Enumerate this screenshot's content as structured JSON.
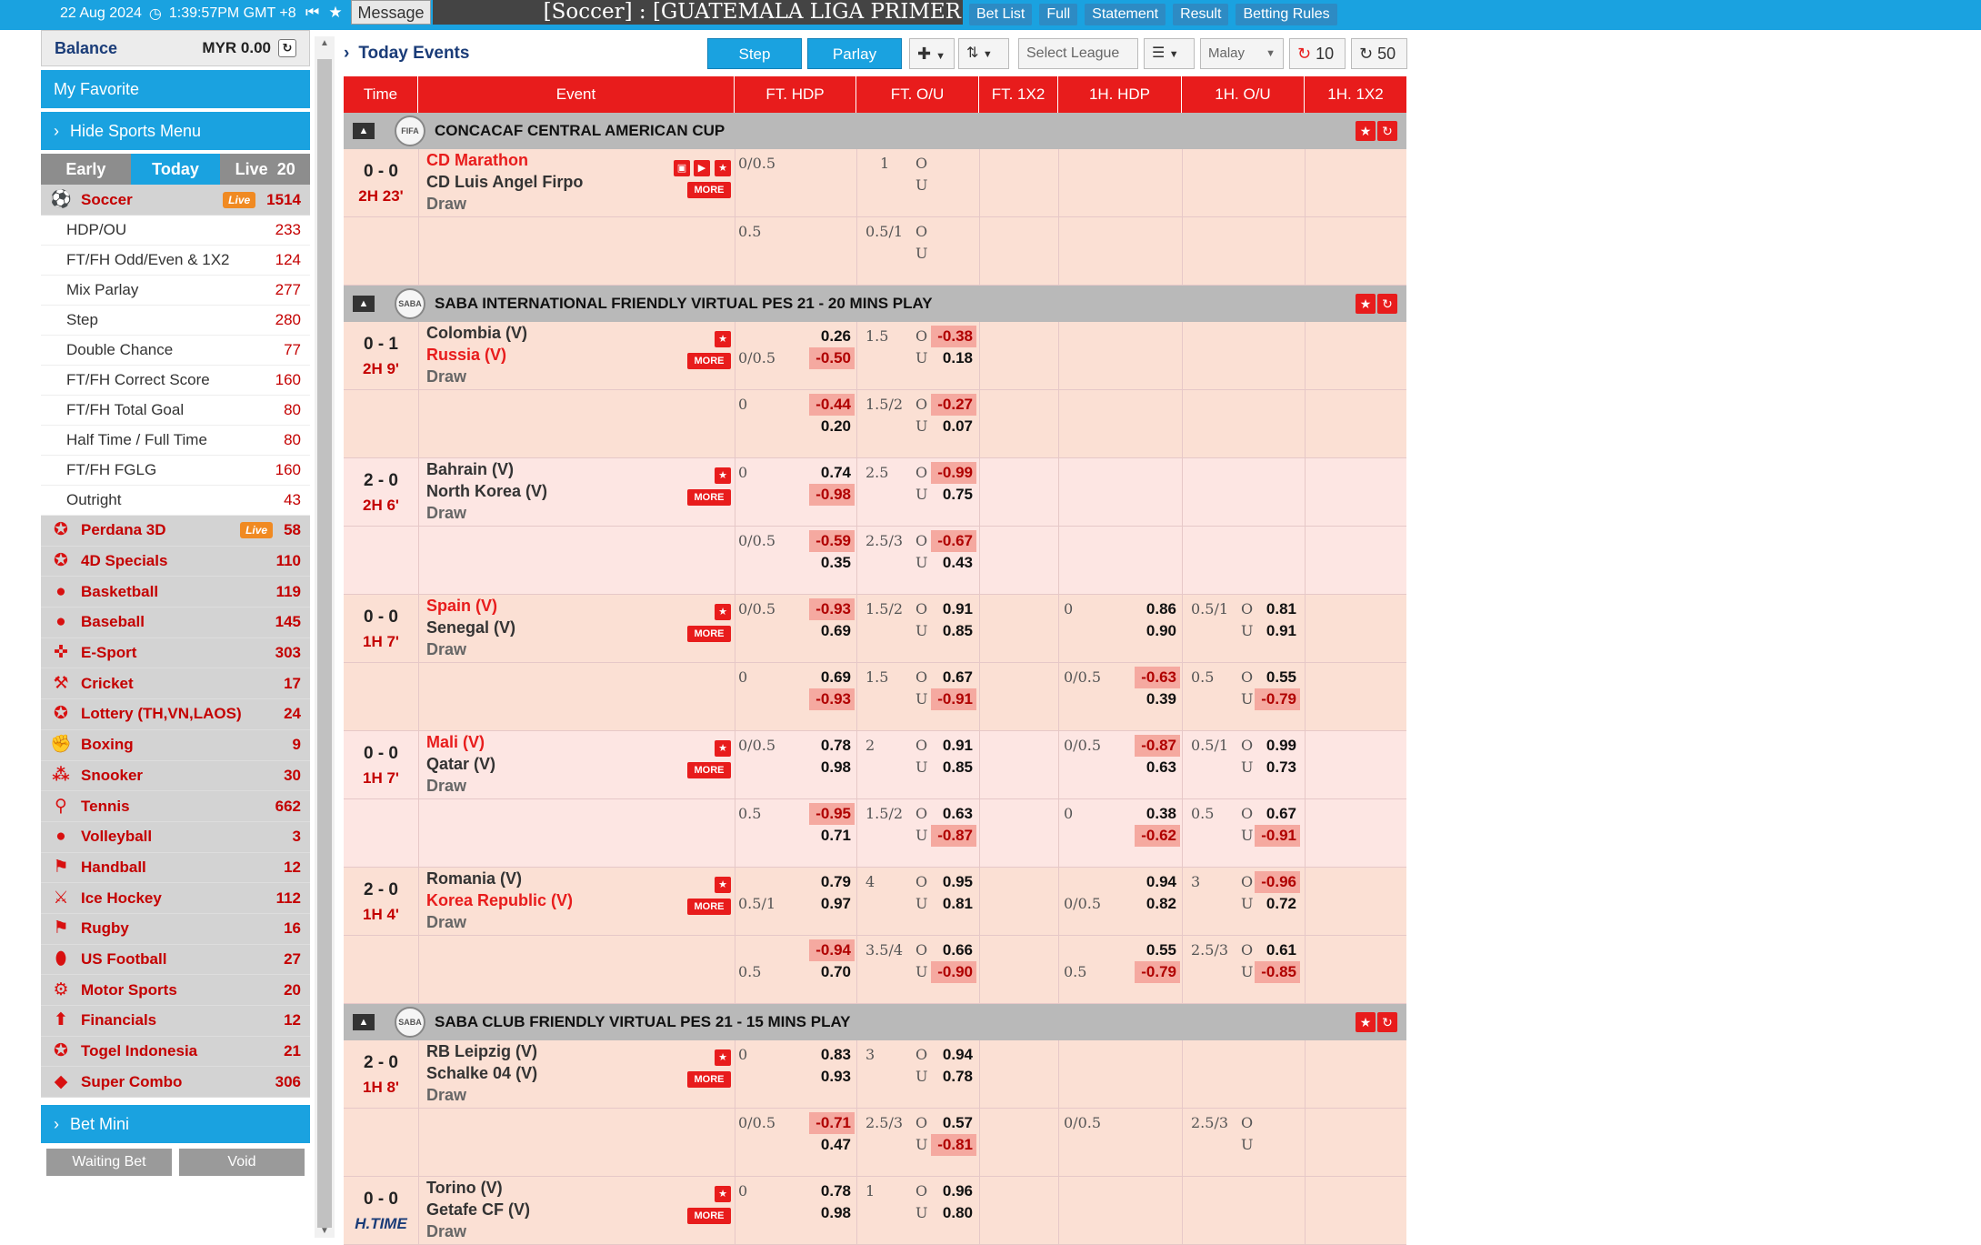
{
  "topbar": {
    "date": "22 Aug 2024",
    "time": "1:39:57PM GMT +8",
    "message_label": "Message",
    "ticker": "[Soccer] : [GUATEMALA LIGA PRIMER",
    "links": [
      "Bet List",
      "Full",
      "Statement",
      "Result",
      "Betting Rules"
    ]
  },
  "sidebar": {
    "balance_label": "Balance",
    "balance_value": "MYR 0.00",
    "favorite_label": "My Favorite",
    "hide_menu_label": "Hide Sports Menu",
    "tabs": {
      "early": "Early",
      "today": "Today",
      "live": "Live",
      "live_count": "20"
    },
    "soccer": {
      "name": "Soccer",
      "live": "Live",
      "count": "1514"
    },
    "soccer_sub": [
      {
        "name": "HDP/OU",
        "count": "233"
      },
      {
        "name": "FT/FH Odd/Even & 1X2",
        "count": "124"
      },
      {
        "name": "Mix Parlay",
        "count": "277"
      },
      {
        "name": "Step",
        "count": "280"
      },
      {
        "name": "Double Chance",
        "count": "77"
      },
      {
        "name": "FT/FH Correct Score",
        "count": "160"
      },
      {
        "name": "FT/FH Total Goal",
        "count": "80"
      },
      {
        "name": "Half Time / Full Time",
        "count": "80"
      },
      {
        "name": "FT/FH FGLG",
        "count": "160"
      },
      {
        "name": "Outright",
        "count": "43"
      }
    ],
    "sports": [
      {
        "name": "Perdana 3D",
        "live": "Live",
        "count": "58",
        "icon": "lottery-icon"
      },
      {
        "name": "4D Specials",
        "count": "110",
        "icon": "lottery-icon"
      },
      {
        "name": "Basketball",
        "count": "119",
        "icon": "basketball-icon"
      },
      {
        "name": "Baseball",
        "count": "145",
        "icon": "baseball-icon"
      },
      {
        "name": "E-Sport",
        "count": "303",
        "icon": "gamepad-icon"
      },
      {
        "name": "Cricket",
        "count": "17",
        "icon": "cricket-icon"
      },
      {
        "name": "Lottery (TH,VN,LAOS)",
        "count": "24",
        "icon": "lottery-icon"
      },
      {
        "name": "Boxing",
        "count": "9",
        "icon": "boxing-icon"
      },
      {
        "name": "Snooker",
        "count": "30",
        "icon": "snooker-icon"
      },
      {
        "name": "Tennis",
        "count": "662",
        "icon": "tennis-icon"
      },
      {
        "name": "Volleyball",
        "count": "3",
        "icon": "volleyball-icon"
      },
      {
        "name": "Handball",
        "count": "12",
        "icon": "handball-icon"
      },
      {
        "name": "Ice Hockey",
        "count": "112",
        "icon": "hockey-icon"
      },
      {
        "name": "Rugby",
        "count": "16",
        "icon": "rugby-icon"
      },
      {
        "name": "US Football",
        "count": "27",
        "icon": "football-icon"
      },
      {
        "name": "Motor Sports",
        "count": "20",
        "icon": "motor-icon"
      },
      {
        "name": "Financials",
        "count": "12",
        "icon": "chart-icon"
      },
      {
        "name": "Togel Indonesia",
        "count": "21",
        "icon": "lottery-icon"
      },
      {
        "name": "Super Combo",
        "count": "306",
        "icon": "combo-icon"
      }
    ],
    "bet_mini_label": "Bet Mini",
    "waiting_bet_label": "Waiting Bet",
    "void_label": "Void"
  },
  "toolbar": {
    "title": "Today Events",
    "step_label": "Step",
    "parlay_label": "Parlay",
    "select_league": "Select League",
    "lang": "Malay",
    "refresh1": "10",
    "refresh2": "50"
  },
  "table": {
    "headers": [
      "Time",
      "Event",
      "FT. HDP",
      "FT. O/U",
      "FT. 1X2",
      "1H. HDP",
      "1H. O/U",
      "1H. 1X2"
    ],
    "draw_label": "Draw",
    "more_label": "MORE",
    "leagues": [
      {
        "name": "CONCACAF CENTRAL AMERICAN CUP",
        "logo": "FIFA"
      },
      {
        "name": "SABA INTERNATIONAL FRIENDLY VIRTUAL PES 21 - 20 MINS PLAY",
        "logo": "SABA"
      },
      {
        "name": "SABA CLUB FRIENDLY VIRTUAL PES 21 - 15 MINS PLAY",
        "logo": "SABA"
      }
    ],
    "matches": [
      {
        "score": "0 - 0",
        "time": "2H 23'",
        "home": "CD Marathon",
        "away": "CD Luis Angel Firpo"
      },
      {
        "score": "0 - 1",
        "time": "2H 9'",
        "home": "Colombia (V)",
        "away": "Russia (V)"
      },
      {
        "score": "2 - 0",
        "time": "2H 6'",
        "home": "Bahrain (V)",
        "away": "North Korea (V)"
      },
      {
        "score": "0 - 0",
        "time": "1H 7'",
        "home": "Spain (V)",
        "away": "Senegal (V)"
      },
      {
        "score": "0 - 0",
        "time": "1H 7'",
        "home": "Mali (V)",
        "away": "Qatar (V)"
      },
      {
        "score": "2 - 0",
        "time": "1H 4'",
        "home": "Romania (V)",
        "away": "Korea Republic (V)"
      },
      {
        "score": "2 - 0",
        "time": "1H 8'",
        "home": "RB Leipzig (V)",
        "away": "Schalke 04 (V)"
      },
      {
        "score": "0 - 0",
        "time": "H.TIME",
        "home": "Torino (V)",
        "away": "Getafe CF (V)"
      }
    ],
    "odds_text": {
      "r1": [
        "0/0.5",
        "1",
        "O",
        "U"
      ],
      "r2": [
        "0.5",
        "0.5/1",
        "O",
        "U"
      ],
      "r3": [
        "0/0.5",
        "0.26",
        "-0.50",
        "1.5",
        "O",
        "U",
        "-0.38",
        "0.18"
      ],
      "r4": [
        "0",
        "-0.44",
        "0.20",
        "1.5/2",
        "O",
        "U",
        "-0.27",
        "0.07"
      ],
      "r5": [
        "0",
        "0.74",
        "-0.98",
        "2.5",
        "O",
        "U",
        "-0.99",
        "0.75"
      ],
      "r6": [
        "0/0.5",
        "-0.59",
        "0.35",
        "2.5/3",
        "O",
        "U",
        "-0.67",
        "0.43"
      ],
      "r7": [
        "0/0.5",
        "-0.93",
        "0.69",
        "1.5/2",
        "O",
        "U",
        "0.91",
        "0.85",
        "0",
        "0.86",
        "0.90",
        "0.5/1",
        "O",
        "U",
        "0.81",
        "0.91"
      ],
      "r8": [
        "0",
        "0.69",
        "-0.93",
        "1.5",
        "O",
        "U",
        "0.67",
        "-0.91",
        "0/0.5",
        "-0.63",
        "0.39",
        "0.5",
        "O",
        "U",
        "0.55",
        "-0.79"
      ],
      "r9": [
        "0/0.5",
        "0.78",
        "0.98",
        "2",
        "O",
        "U",
        "0.91",
        "0.85",
        "0/0.5",
        "-0.87",
        "0.63",
        "0.5/1",
        "O",
        "U",
        "0.99",
        "0.73"
      ],
      "r10": [
        "0.5",
        "-0.95",
        "0.71",
        "1.5/2",
        "O",
        "U",
        "0.63",
        "-0.87",
        "0",
        "0.38",
        "-0.62",
        "0.5",
        "O",
        "U",
        "0.67",
        "-0.91"
      ],
      "r11": [
        "0.5/1",
        "0.79",
        "0.97",
        "4",
        "O",
        "U",
        "0.95",
        "0.81",
        "0/0.5",
        "0.94",
        "0.82",
        "3",
        "O",
        "U",
        "-0.96",
        "0.72"
      ],
      "r12": [
        "0.5",
        "-0.94",
        "0.70",
        "3.5/4",
        "O",
        "U",
        "0.66",
        "-0.90",
        "0.5",
        "0.55",
        "-0.79",
        "2.5/3",
        "O",
        "U",
        "0.61",
        "-0.85"
      ],
      "r13": [
        "0",
        "0.83",
        "0.93",
        "3",
        "O",
        "U",
        "0.94",
        "0.78"
      ],
      "r14": [
        "0/0.5",
        "-0.71",
        "0.47",
        "2.5/3",
        "O",
        "U",
        "0.57",
        "-0.81",
        "0/0.5",
        "2.5/3",
        "O",
        "U"
      ],
      "r15": [
        "0",
        "0.78",
        "0.98",
        "1",
        "O",
        "U",
        "0.96",
        "0.80"
      ]
    }
  },
  "colors": {
    "accent": "#1aa2e0",
    "header_red": "#e81c1c",
    "row_a": "#fbe0d4",
    "row_b": "#fde6e3",
    "league_bg": "#b9b9b9",
    "neg_bg": "#f5a9a0"
  }
}
